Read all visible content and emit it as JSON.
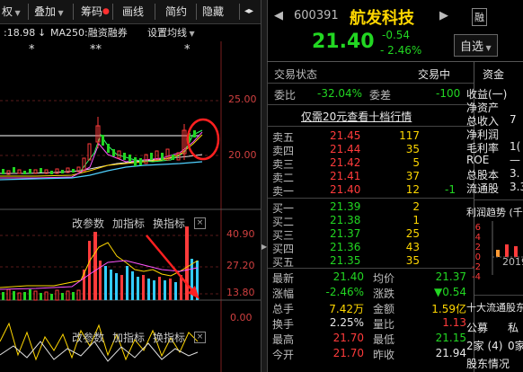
{
  "toolbar": {
    "items": [
      {
        "label": "权",
        "has_dropdown": true
      },
      {
        "label": "叠加",
        "has_dropdown": true
      },
      {
        "label": "筹码",
        "has_dot": true
      },
      {
        "label": "画线"
      },
      {
        "label": "简约"
      },
      {
        "label": "隐藏"
      },
      {
        "label": "◂▸"
      }
    ]
  },
  "chart": {
    "info_value": ":18.98",
    "info_arrow": "↓",
    "ma_label": "MA250:融资融券",
    "settings_label": "设置均线",
    "stars": [
      "*",
      "**",
      "*"
    ],
    "price_axis": [
      "25.00",
      "20.00"
    ],
    "indicator1": {
      "change_param": "改参数",
      "add_indicator": "加指标",
      "switch_indicator": "换指标",
      "axis": [
        "40.90",
        "27.20",
        "13.80",
        "0.00"
      ]
    },
    "indicator2": {
      "change_param": "改参数",
      "add_indicator": "加指标",
      "switch_indicator": "换指标"
    }
  },
  "stock": {
    "code": "600391",
    "name": "航发科技",
    "badge": "融",
    "price": "21.40",
    "change": "-0.54",
    "change_pct": "- 2.46%",
    "add_watch": "自选",
    "trade_status_label": "交易状态",
    "trade_status_value": "交易中",
    "weibi_label": "委比",
    "weibi_value": "-32.04%",
    "weicha_label": "委差",
    "weicha_value": "-100",
    "level10_link": "仅需20元查看十档行情"
  },
  "order_book": {
    "asks": [
      {
        "label": "卖五",
        "price": "21.45",
        "vol": "117",
        "chg": ""
      },
      {
        "label": "卖四",
        "price": "21.44",
        "vol": "35",
        "chg": ""
      },
      {
        "label": "卖三",
        "price": "21.42",
        "vol": "5",
        "chg": ""
      },
      {
        "label": "卖二",
        "price": "21.41",
        "vol": "37",
        "chg": ""
      },
      {
        "label": "卖一",
        "price": "21.40",
        "vol": "12",
        "chg": "-1"
      }
    ],
    "bids": [
      {
        "label": "买一",
        "price": "21.39",
        "vol": "2",
        "chg": ""
      },
      {
        "label": "买二",
        "price": "21.38",
        "vol": "1",
        "chg": ""
      },
      {
        "label": "买三",
        "price": "21.37",
        "vol": "25",
        "chg": ""
      },
      {
        "label": "买四",
        "price": "21.36",
        "vol": "43",
        "chg": ""
      },
      {
        "label": "买五",
        "price": "21.35",
        "vol": "35",
        "chg": ""
      }
    ]
  },
  "quote": [
    {
      "l1": "最新",
      "v1": "21.40",
      "c1": "green",
      "l2": "均价",
      "v2": "21.37",
      "c2": "green"
    },
    {
      "l1": "涨幅",
      "v1": "-2.46%",
      "c1": "green",
      "l2": "涨跌",
      "v2": "▼0.54",
      "c2": "green"
    },
    {
      "l1": "总手",
      "v1": "7.42万",
      "c1": "yellow",
      "l2": "金额",
      "v2": "1.59亿",
      "c2": "yellow"
    },
    {
      "l1": "换手",
      "v1": "2.25%",
      "c1": "white",
      "l2": "量比",
      "v2": "1.13",
      "c2": "red"
    },
    {
      "l1": "最高",
      "v1": "21.70",
      "c1": "red",
      "l2": "最低",
      "v2": "21.15",
      "c2": "green"
    },
    {
      "l1": "今开",
      "v1": "21.70",
      "c1": "red",
      "l2": "昨收",
      "v2": "21.94",
      "c2": "white"
    }
  ],
  "fundamentals": {
    "tab": "资金",
    "rows": [
      {
        "label": "收益(一)",
        "value": ""
      },
      {
        "label": "净资产",
        "value": ""
      },
      {
        "label": "总收入",
        "value": "7"
      },
      {
        "label": "净利润",
        "value": ""
      },
      {
        "label": "毛利率",
        "value": "1("
      },
      {
        "label": "ROE",
        "value": "—"
      },
      {
        "label": "总股本",
        "value": "3."
      },
      {
        "label": "流通股",
        "value": "3.3"
      }
    ],
    "trend_title": "利润趋势 (千",
    "trend_axis": [
      "6",
      "4",
      "2",
      "0",
      "-2",
      "-4"
    ],
    "trend_year": "2019",
    "holders_title": "十大流通股东",
    "holders_cols": [
      "公募",
      "私"
    ],
    "holders_vals": [
      "2家 (4)",
      "0家"
    ],
    "holders_info": "股东情况"
  },
  "colors": {
    "up": "#ff3b3b",
    "down": "#22d622",
    "accent": "#ffd700",
    "bg": "#000000"
  }
}
